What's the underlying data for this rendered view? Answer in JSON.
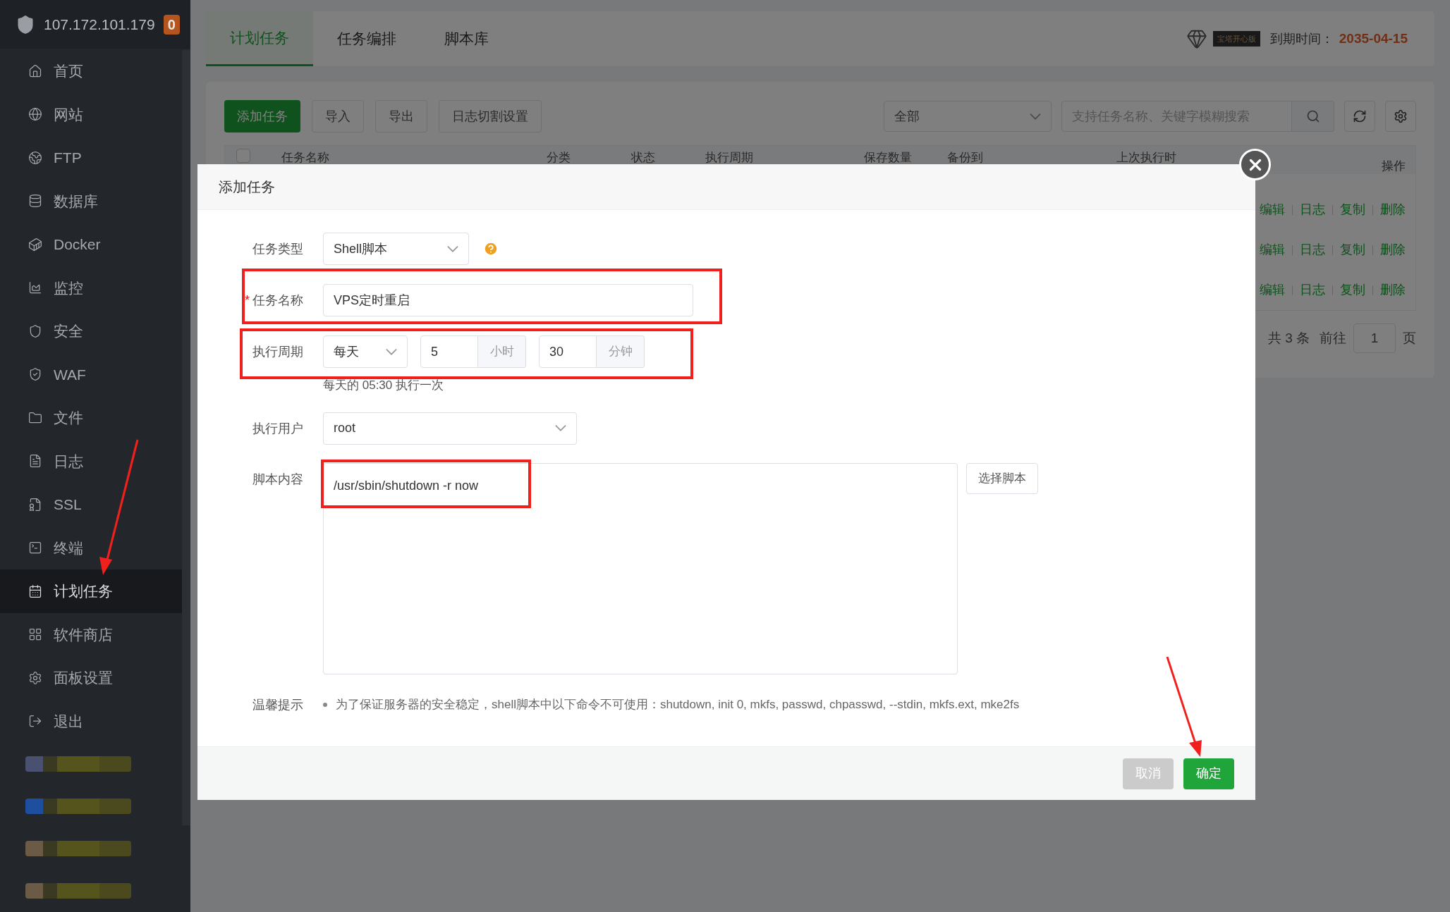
{
  "sidebar": {
    "host": "107.172.101.179",
    "badge": "0",
    "items": [
      {
        "label": "首页",
        "selected": false
      },
      {
        "label": "网站",
        "selected": false
      },
      {
        "label": "FTP",
        "selected": false
      },
      {
        "label": "数据库",
        "selected": false
      },
      {
        "label": "Docker",
        "selected": false
      },
      {
        "label": "监控",
        "selected": false
      },
      {
        "label": "安全",
        "selected": false
      },
      {
        "label": "WAF",
        "selected": false
      },
      {
        "label": "文件",
        "selected": false
      },
      {
        "label": "日志",
        "selected": false
      },
      {
        "label": "SSL",
        "selected": false
      },
      {
        "label": "终端",
        "selected": false
      },
      {
        "label": "计划任务",
        "selected": true
      },
      {
        "label": "软件商店",
        "selected": false
      },
      {
        "label": "面板设置",
        "selected": false
      },
      {
        "label": "退出",
        "selected": false
      }
    ]
  },
  "tabs": [
    {
      "label": "计划任务",
      "selected": true
    },
    {
      "label": "任务编排",
      "selected": false
    },
    {
      "label": "脚本库",
      "selected": false
    }
  ],
  "license": {
    "badge": "宝塔开心版",
    "label": "到期时间：",
    "date": "2035-04-15"
  },
  "toolbar": {
    "buttons": [
      {
        "label": "添加任务",
        "kind": "primary"
      },
      {
        "label": "导入",
        "kind": "plain"
      },
      {
        "label": "导出",
        "kind": "plain"
      },
      {
        "label": "日志切割设置",
        "kind": "plain"
      }
    ],
    "filter": "全部",
    "search_placeholder": "支持任务名称、关键字模糊搜索"
  },
  "table": {
    "select_all_checked": false,
    "columns": [
      "任务名称",
      "分类",
      "状态",
      "执行周期",
      "保存数量",
      "备份到",
      "上次执行时",
      "操作"
    ],
    "rows": [
      {
        "actions": [
          "编辑",
          "日志",
          "复制",
          "删除"
        ]
      },
      {
        "actions": [
          "编辑",
          "日志",
          "复制",
          "删除"
        ]
      },
      {
        "actions": [
          "编辑",
          "日志",
          "复制",
          "删除"
        ]
      }
    ]
  },
  "pagination": {
    "total": "共 3 条",
    "goto": "前往",
    "page": "1",
    "unit": "页"
  },
  "dialog": {
    "title": "添加任务",
    "fields": [
      {
        "kind": "select",
        "label": "任务类型",
        "value": "Shell脚本",
        "help": true
      },
      {
        "kind": "input",
        "label": "任务名称",
        "required_mark": "*",
        "value": "VPS定时重启"
      },
      {
        "kind": "schedule",
        "label": "执行周期",
        "period": "每天",
        "hour": "5",
        "hour_unit": "小时",
        "minute": "30",
        "minute_unit": "分钟",
        "hint": "每天的 05:30 执行一次"
      },
      {
        "kind": "select",
        "label": "执行用户",
        "value": "root"
      },
      {
        "kind": "script",
        "label": "脚本内容",
        "value": "/usr/sbin/shutdown -r now",
        "button": "选择脚本"
      }
    ],
    "tip": {
      "label": "温馨提示",
      "text": "为了保证服务器的安全稳定，shell脚本中以下命令不可使用：shutdown, init 0, mkfs, passwd, chpasswd, --stdin, mkfs.ext, mke2fs"
    },
    "buttons": [
      {
        "label": "取消",
        "kind": "cancel"
      },
      {
        "label": "确定",
        "kind": "confirm"
      }
    ]
  }
}
